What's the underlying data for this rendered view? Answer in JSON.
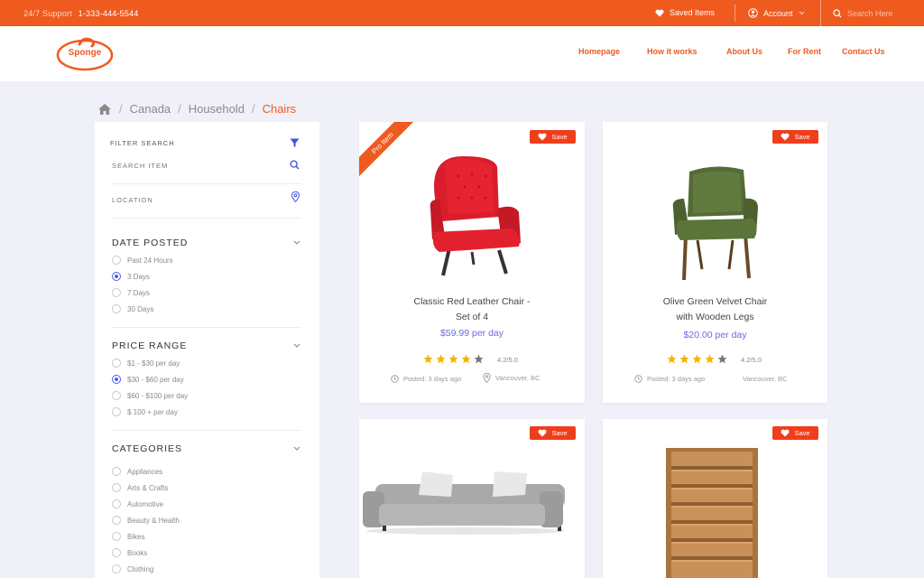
{
  "topbar": {
    "support_label": "24/7 Support",
    "support_phone": "1-333-444-5544",
    "saved_items": "Saved Items",
    "account": "Account",
    "search_placeholder": "Search Here"
  },
  "header": {
    "logo_text": "Sponge",
    "nav": [
      "Homepage",
      "How it works",
      "About Us",
      "For Rent",
      "Contact Us"
    ]
  },
  "breadcrumb": [
    "Canada",
    "Household",
    "Chairs"
  ],
  "sidebar": {
    "filter_title": "FILTER SEARCH",
    "search_placeholder": "SEARCH ITEM",
    "location_placeholder": "LOCATION",
    "date_posted": {
      "title": "DATE POSTED",
      "options": [
        "Past 24 Hours",
        "3 Days",
        "7 Days",
        "30 Days"
      ],
      "selected": 1
    },
    "price_range": {
      "title": "PRICE RANGE",
      "options": [
        "$1 - $30 per day",
        "$30 - $60 per day",
        "$60 - $100 per day",
        "$ 100 + per day"
      ],
      "selected": 1
    },
    "categories": {
      "title": "CATEGORIES",
      "options": [
        "Appliances",
        "Arts & Crafts",
        "Automotive",
        "Beauty & Health",
        "Bikes",
        "Books",
        "Clothing"
      ]
    }
  },
  "cards": [
    {
      "ribbon": "Pro Item",
      "save": "Save",
      "title_line1": "Classic Red Leather Chair -",
      "title_line2": "Set of 4",
      "price": "$59.99 per day",
      "rating": "4.2/5.0",
      "stars": 4,
      "posted": "Posted: 3 days ago",
      "location": "Vancouver, BC",
      "image": "red-wingback-chair"
    },
    {
      "save": "Save",
      "title_line1": "Olive Green Velvet Chair",
      "title_line2": "with Wooden Legs",
      "price": "$20.00 per day",
      "rating": "4.2/5.0",
      "stars": 4,
      "posted": "Posted: 3 days ago",
      "location": "Vancouver, BC",
      "image": "green-velvet-chair"
    },
    {
      "save": "Save",
      "image": "grey-sofa"
    },
    {
      "save": "Save",
      "image": "wooden-bookshelf"
    }
  ],
  "colors": {
    "accent": "#ef5a1e",
    "save": "#ef3e1b",
    "price": "#6a6ae3",
    "star": "#f5b301",
    "radio": "#4e5de6"
  }
}
